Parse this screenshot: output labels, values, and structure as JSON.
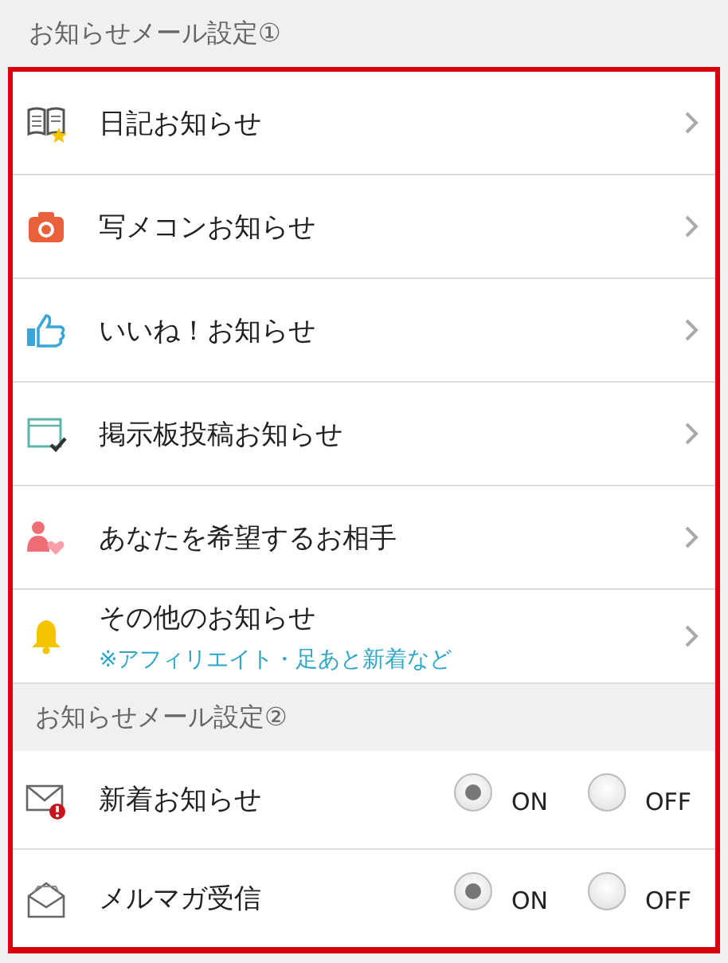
{
  "section1": {
    "title": "お知らせメール設定①",
    "items": [
      {
        "kind": "book",
        "label": "日記お知らせ"
      },
      {
        "kind": "camera",
        "label": "写メコンお知らせ"
      },
      {
        "kind": "thumb",
        "label": "いいね！お知らせ"
      },
      {
        "kind": "board",
        "label": "掲示板投稿お知らせ"
      },
      {
        "kind": "person",
        "label": "あなたを希望するお相手"
      },
      {
        "kind": "bell",
        "label": "その他のお知らせ",
        "note": "※アフィリエイト・足あと新着など"
      }
    ]
  },
  "section2": {
    "title": "お知らせメール設定②",
    "items": [
      {
        "kind": "mail-alert",
        "label": "新着お知らせ",
        "options": [
          {
            "label": "ON",
            "selected": true
          },
          {
            "label": "OFF",
            "selected": false
          }
        ]
      },
      {
        "kind": "mail-open",
        "label": "メルマガ受信",
        "options": [
          {
            "label": "ON",
            "selected": true
          },
          {
            "label": "OFF",
            "selected": false
          }
        ]
      }
    ]
  }
}
